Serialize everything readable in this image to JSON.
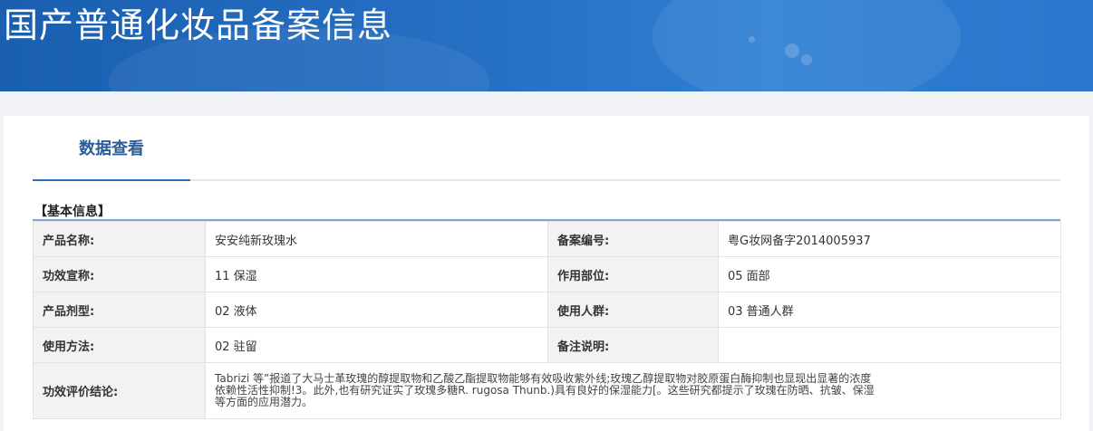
{
  "header": {
    "title": "国产普通化妆品备案信息"
  },
  "tabs": [
    {
      "label": "数据查看",
      "active": true
    }
  ],
  "section": {
    "title": "【基本信息】"
  },
  "fields": {
    "product_name": {
      "label": "产品名称:",
      "value": "安安纯新玫瑰水"
    },
    "record_no": {
      "label": "备案编号:",
      "value": "粤G妆网备字2014005937"
    },
    "efficacy_claim": {
      "label": "功效宣称:",
      "value": "11 保湿"
    },
    "application_site": {
      "label": "作用部位:",
      "value": "05 面部"
    },
    "dosage_form": {
      "label": "产品剂型:",
      "value": "02 液体"
    },
    "target_group": {
      "label": "使用人群:",
      "value": "03 普通人群"
    },
    "usage_method": {
      "label": "使用方法:",
      "value": "02 驻留"
    },
    "remarks": {
      "label": "备注说明:",
      "value": ""
    },
    "efficacy_conclusion": {
      "label": "功效评价结论:",
      "value": "Tabrizi 等”报道了大马士革玫瑰的醇提取物和乙酸乙酯提取物能够有效吸收紫外线;玫瑰乙醇提取物对胶原蛋白酶抑制也显现出显著的浓度依赖性活性抑制!3。此外,也有研究证实了玫瑰多糖R. rugosa Thunb.)具有良好的保湿能力[。这些研究都提示了玫瑰在防晒、抗皱、保湿等方面的应用潜力。"
    }
  },
  "colors": {
    "banner": "#2670c4",
    "tab_active": "#2a5c9a",
    "label_bg": "#f2f2f2"
  }
}
